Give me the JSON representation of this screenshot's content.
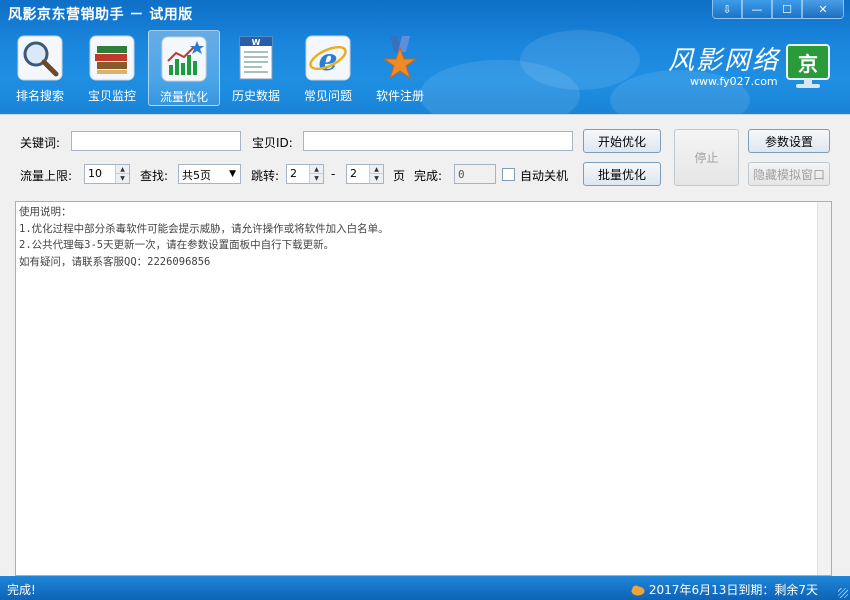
{
  "window": {
    "title": "风影京东营销助手 － 试用版",
    "controls": [
      "⇩",
      "—",
      "☐",
      "✕"
    ]
  },
  "toolbar": {
    "items": [
      {
        "label": "排名搜索",
        "icon": "magnifier-icon",
        "active": false
      },
      {
        "label": "宝贝监控",
        "icon": "books-icon",
        "active": false
      },
      {
        "label": "流量优化",
        "icon": "bar-chart-icon",
        "active": true
      },
      {
        "label": "历史数据",
        "icon": "word-document-icon",
        "active": false
      },
      {
        "label": "常见问题",
        "icon": "ie-browser-icon",
        "active": false
      },
      {
        "label": "软件注册",
        "icon": "medal-star-icon",
        "active": false
      }
    ]
  },
  "brand": {
    "name": "风影网络",
    "url": "www.fy027.com",
    "badge": "京"
  },
  "form": {
    "keyword_label": "关键词:",
    "keyword_value": "",
    "item_id_label": "宝贝ID:",
    "item_id_value": "",
    "traffic_limit_label": "流量上限:",
    "traffic_limit_value": "10",
    "find_label": "查找:",
    "find_value": "共5页",
    "jump_label": "跳转:",
    "jump_from": "2",
    "jump_dash": "-",
    "jump_to": "2",
    "page_unit": "页",
    "done_label": "完成:",
    "done_value": "0",
    "auto_shutdown_label": "自动关机",
    "auto_shutdown_checked": false
  },
  "buttons": {
    "start": "开始优化",
    "batch": "批量优化",
    "stop": "停止",
    "settings": "参数设置",
    "hide_window": "隐藏模拟窗口"
  },
  "log": {
    "lines": [
      "使用说明：",
      "1.优化过程中部分杀毒软件可能会提示威胁，请允许操作或将软件加入白名单。",
      "2.公共代理每3-5天更新一次，请在参数设置面板中自行下载更新。",
      "",
      "如有疑问，请联系客服QQ：2226096856"
    ]
  },
  "status": {
    "left": "完成!",
    "right": "2017年6月13日到期：剩余7天"
  }
}
